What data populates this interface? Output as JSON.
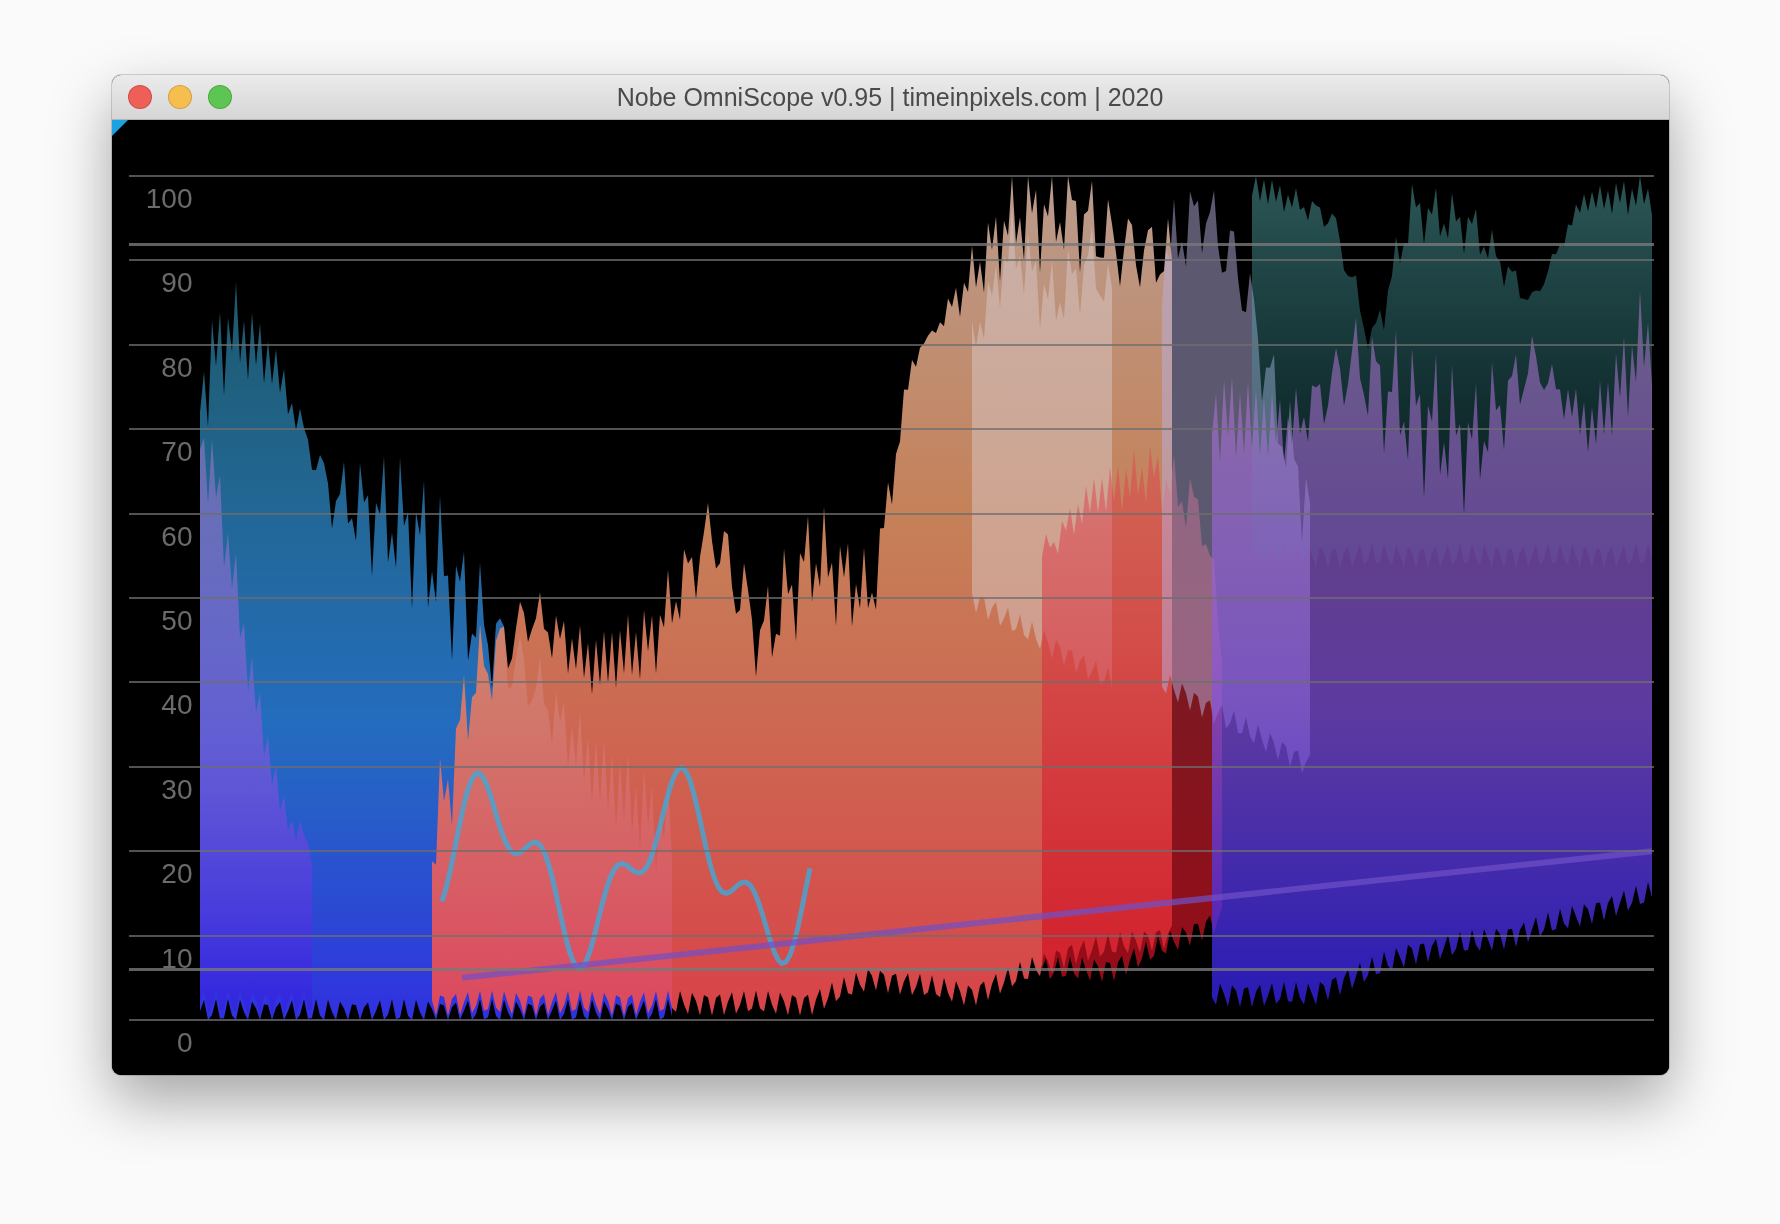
{
  "window": {
    "title": "Nobe OmniScope v0.95 | timeinpixels.com | 2020"
  },
  "scope": {
    "scale": [
      "100",
      "90",
      "80",
      "70",
      "60",
      "50",
      "40",
      "30",
      "20",
      "10",
      "0"
    ]
  }
}
